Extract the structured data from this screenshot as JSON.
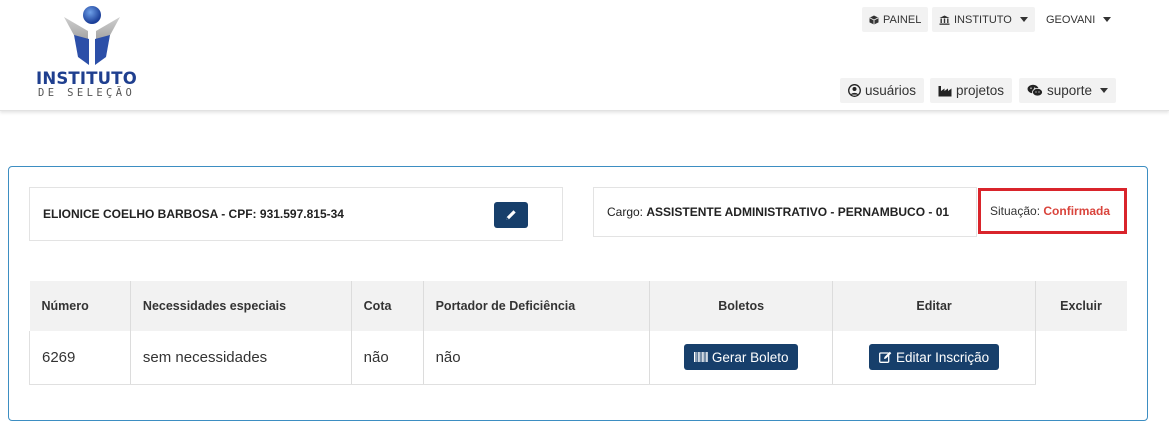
{
  "brand": {
    "name": "INSTITUTO",
    "subtitle": "DE SELEÇÃO"
  },
  "top_nav": {
    "painel": "PAINEL",
    "instituto": "INSTITUTO",
    "user": "GEOVANI"
  },
  "sub_nav": {
    "usuarios": "usuários",
    "projetos": "projetos",
    "suporte": "suporte"
  },
  "candidate": {
    "name_cpf": "ELIONICE COELHO BARBOSA - CPF: 931.597.815-34",
    "cargo_label": "Cargo:",
    "cargo_value": "ASSISTENTE ADMINISTRATIVO - PERNAMBUCO - 01",
    "situacao_label": "Situação:",
    "situacao_value": "Confirmada"
  },
  "table": {
    "headers": [
      "Número",
      "Necessidades especiais",
      "Cota",
      "Portador de Deficiência",
      "Boletos",
      "Editar",
      "Excluir"
    ],
    "rows": [
      {
        "numero": "6269",
        "necessidades": "sem necessidades",
        "cota": "não",
        "deficiencia": "não",
        "boleto_label": "Gerar Boleto",
        "editar_label": "Editar Inscrição"
      }
    ]
  },
  "colors": {
    "primary_button": "#173f6b",
    "panel_border": "#3d8ec2",
    "status_confirmed": "#d9443c",
    "highlight": "#d9242b"
  },
  "icons": [
    "cube-icon",
    "bank-icon",
    "user-circle-icon",
    "industry-icon",
    "wechat-icon",
    "pencil-icon",
    "barcode-icon",
    "edit-icon"
  ]
}
